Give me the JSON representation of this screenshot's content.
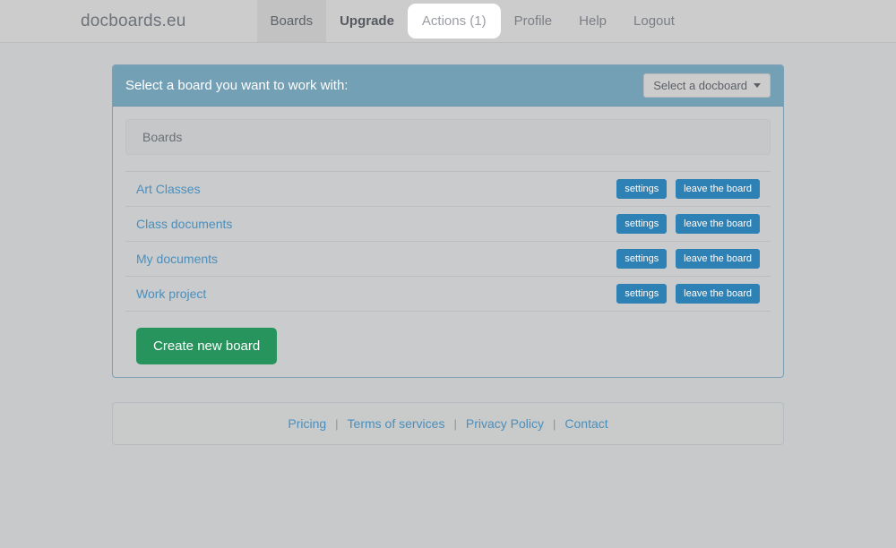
{
  "navbar": {
    "brand": "docboards.eu",
    "items": [
      {
        "label": "Boards",
        "state": "active-dark"
      },
      {
        "label": "Upgrade",
        "state": "strong"
      },
      {
        "label": "Actions (1)",
        "state": "tab-white"
      },
      {
        "label": "Profile",
        "state": "normal"
      },
      {
        "label": "Help",
        "state": "normal"
      },
      {
        "label": "Logout",
        "state": "normal"
      }
    ]
  },
  "panel": {
    "title": "Select a board you want to work with:",
    "dropdown_label": "Select a docboard",
    "dropdown_icon": "caret-down-icon",
    "subheader": "Boards",
    "create_button": "Create new board",
    "row_buttons": {
      "settings": "settings",
      "leave": "leave the board"
    },
    "boards": [
      {
        "name": "Art Classes"
      },
      {
        "name": "Class documents"
      },
      {
        "name": "My documents"
      },
      {
        "name": "Work project"
      }
    ]
  },
  "footer": {
    "separator": "|",
    "links": [
      {
        "label": "Pricing"
      },
      {
        "label": "Terms of services"
      },
      {
        "label": "Privacy Policy"
      },
      {
        "label": "Contact"
      }
    ]
  },
  "colors": {
    "page_background": "#c8c9ca",
    "navbar_background": "#cccccc",
    "panel_header": "#74a0b5",
    "panel_border": "#7ba0b5",
    "link_blue": "#4a8fbd",
    "button_blue": "#2e81b4",
    "create_green": "#27945e",
    "tab_white": "#ffffff"
  }
}
